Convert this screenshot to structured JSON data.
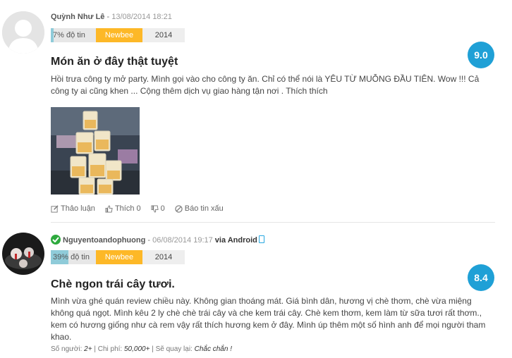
{
  "review1": {
    "username": "Quỳnh Như Lê",
    "separator": " - ",
    "date": "13/08/2014 18:21",
    "trust_label": "7% độ tin",
    "trust_percent": 7,
    "level": "Newbee",
    "year": "2014",
    "score": "9.0",
    "title": "Món ăn ở đây thật tuyệt",
    "text": "Hồi trưa công ty mở party. Mình gọi vào cho công ty ăn. Chỉ có thể nói là YÊU TỪ MUỖNG ĐẦU TIÊN. Wow !!! Cả công ty ai cũng khen ... Cộng thêm dịch vụ giao hàng tận nơi . Thích thích",
    "actions": {
      "discuss": "Thảo luận",
      "like": "Thích 0",
      "dislike": "0",
      "report": "Báo tin xấu"
    }
  },
  "review2": {
    "username": "Nguyentoandophuong",
    "separator": " - ",
    "date": "06/08/2014 19:17",
    "via": "via Android",
    "trust_label": "39% độ tin",
    "trust_percent": 39,
    "level": "Newbee",
    "year": "2014",
    "score": "8.4",
    "title": "Chè ngon trái cây tươi.",
    "text": "Mình vừa ghé quán review chiều này. Không gian thoáng mát. Giá bình dân, hương vị chè thơm, chè vừa miệng không quá ngọt. Mình kêu 2 ly chè chè trái cây và che kem trái cây. Chè kem thơm, kem làm từ sữa tươi rất thơm., kem có hương giống như cà rem vậy rất thích hương kem ở đây. Mình úp thêm một số hình anh để mọi người tham khao.",
    "info": {
      "people_label": "Số người: ",
      "people": "2+",
      "cost_label": " | Chi phí: ",
      "cost": "50,000+",
      "return_label": " | Sẽ quay lại: ",
      "return": "Chắc chắn !"
    }
  },
  "colors": {
    "score_bg": "#1fa0d6",
    "newbee_bg": "#fdb827",
    "trust_fill": "#8fcbd9",
    "verified": "#2eaa3e"
  }
}
